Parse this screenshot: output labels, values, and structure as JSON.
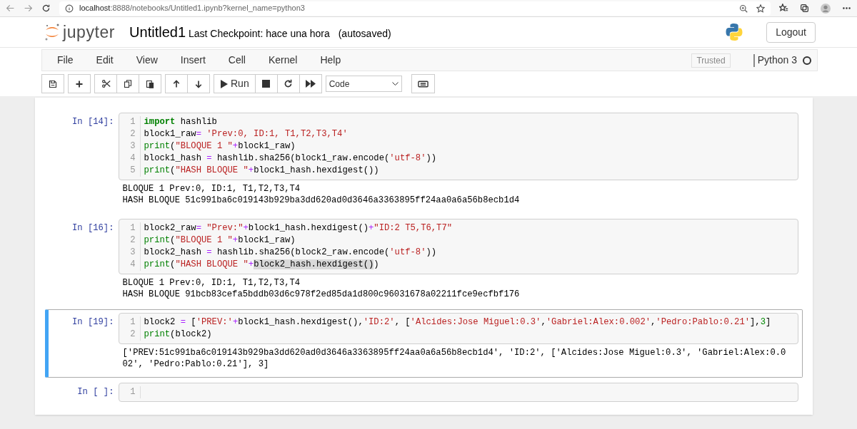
{
  "browser": {
    "url_host": "localhost",
    "url_rest": ":8888/notebooks/Untitled1.ipynb?kernel_name=python3"
  },
  "header": {
    "logo_text": "jupyter",
    "title": "Untitled1",
    "checkpoint": "Last Checkpoint: hace una hora",
    "autosave": "(autosaved)",
    "logout": "Logout"
  },
  "menu": {
    "items": [
      "File",
      "Edit",
      "View",
      "Insert",
      "Cell",
      "Kernel",
      "Help"
    ],
    "trusted": "Trusted",
    "kernel": "Python 3",
    "kernel_busy": false
  },
  "toolbar": {
    "run": "Run",
    "cell_type": "Code"
  },
  "cells": [
    {
      "prompt": "In [14]:",
      "selected": false,
      "lines": [
        {
          "number": "1",
          "tokens": [
            {
              "kind": "keyword",
              "text": "import"
            },
            {
              "kind": "plain",
              "text": " hashlib"
            }
          ]
        },
        {
          "number": "2",
          "tokens": [
            {
              "kind": "plain",
              "text": "block1_raw"
            },
            {
              "kind": "operator",
              "text": "="
            },
            {
              "kind": "string",
              "text": " 'Prev:0, ID:1, T1,T2,T3,T4'"
            }
          ]
        },
        {
          "number": "3",
          "tokens": [
            {
              "kind": "builtin",
              "text": "print"
            },
            {
              "kind": "plain",
              "text": "("
            },
            {
              "kind": "string",
              "text": "\"BLOQUE 1 \""
            },
            {
              "kind": "operator",
              "text": "+"
            },
            {
              "kind": "plain",
              "text": "block1_raw)"
            }
          ]
        },
        {
          "number": "4",
          "tokens": [
            {
              "kind": "plain",
              "text": "block1_hash "
            },
            {
              "kind": "operator",
              "text": "="
            },
            {
              "kind": "plain",
              "text": " hashlib.sha256(block1_raw.encode("
            },
            {
              "kind": "string",
              "text": "'utf-8'"
            },
            {
              "kind": "plain",
              "text": "))"
            }
          ]
        },
        {
          "number": "5",
          "tokens": [
            {
              "kind": "builtin",
              "text": "print"
            },
            {
              "kind": "plain",
              "text": "("
            },
            {
              "kind": "string",
              "text": "\"HASH BLOQUE \""
            },
            {
              "kind": "operator",
              "text": "+"
            },
            {
              "kind": "plain",
              "text": "block1_hash.hexdigest())"
            }
          ]
        }
      ],
      "output": [
        "BLOQUE 1 Prev:0, ID:1, T1,T2,T3,T4",
        "HASH BLOQUE 51c991ba6c019143b929ba3dd620ad0d3646a3363895ff24aa0a6a56b8ecb1d4"
      ]
    },
    {
      "prompt": "In [16]:",
      "selected": false,
      "lines": [
        {
          "number": "1",
          "tokens": [
            {
              "kind": "plain",
              "text": "block2_raw"
            },
            {
              "kind": "operator",
              "text": "="
            },
            {
              "kind": "string",
              "text": " \"Prev:\""
            },
            {
              "kind": "operator",
              "text": "+"
            },
            {
              "kind": "plain",
              "text": "block1_hash.hexdigest()"
            },
            {
              "kind": "operator",
              "text": "+"
            },
            {
              "kind": "string",
              "text": "\"ID:2 T5,T6,T7\""
            }
          ]
        },
        {
          "number": "2",
          "tokens": [
            {
              "kind": "builtin",
              "text": "print"
            },
            {
              "kind": "plain",
              "text": "("
            },
            {
              "kind": "string",
              "text": "\"BLOQUE 1 \""
            },
            {
              "kind": "operator",
              "text": "+"
            },
            {
              "kind": "plain",
              "text": "block1_raw)"
            }
          ]
        },
        {
          "number": "3",
          "tokens": [
            {
              "kind": "plain",
              "text": "block2_hash "
            },
            {
              "kind": "operator",
              "text": "="
            },
            {
              "kind": "plain",
              "text": " hashlib.sha256(block2_raw.encode("
            },
            {
              "kind": "string",
              "text": "'utf-8'"
            },
            {
              "kind": "plain",
              "text": "))"
            }
          ]
        },
        {
          "number": "4",
          "tokens": [
            {
              "kind": "builtin",
              "text": "print"
            },
            {
              "kind": "plain",
              "text": "("
            },
            {
              "kind": "string",
              "text": "\"HASH BLOQUE \""
            },
            {
              "kind": "operator",
              "text": "+"
            },
            {
              "kind": "highlight",
              "text": "block2_hash.hexdigest()"
            },
            {
              "kind": "plain",
              "text": ")"
            }
          ]
        }
      ],
      "output": [
        "BLOQUE 1 Prev:0, ID:1, T1,T2,T3,T4",
        "HASH BLOQUE 91bcb83cefa5bddb03d6c978f2ed85da1d800c96031678a02211fce9ecfbf176"
      ]
    },
    {
      "prompt": "In [19]:",
      "selected": true,
      "lines": [
        {
          "number": "1",
          "tokens": [
            {
              "kind": "plain",
              "text": "block2 "
            },
            {
              "kind": "operator",
              "text": "="
            },
            {
              "kind": "plain",
              "text": " ["
            },
            {
              "kind": "string",
              "text": "'PREV:'"
            },
            {
              "kind": "operator",
              "text": "+"
            },
            {
              "kind": "plain",
              "text": "block1_hash.hexdigest(),"
            },
            {
              "kind": "string",
              "text": "'ID:2'"
            },
            {
              "kind": "plain",
              "text": ", ["
            },
            {
              "kind": "string",
              "text": "'Alcides:Jose Miguel:0.3'"
            },
            {
              "kind": "plain",
              "text": ","
            },
            {
              "kind": "string",
              "text": "'Gabriel:Alex:0.002'"
            },
            {
              "kind": "plain",
              "text": ","
            },
            {
              "kind": "string",
              "text": "'Pedro:Pablo:0.21'"
            },
            {
              "kind": "plain",
              "text": "],"
            },
            {
              "kind": "number",
              "text": "3"
            },
            {
              "kind": "plain",
              "text": "]"
            }
          ]
        },
        {
          "number": "2",
          "tokens": [
            {
              "kind": "builtin",
              "text": "print"
            },
            {
              "kind": "plain",
              "text": "(block2)"
            }
          ]
        }
      ],
      "output": [
        "['PREV:51c991ba6c019143b929ba3dd620ad0d3646a3363895ff24aa0a6a56b8ecb1d4', 'ID:2', ['Alcides:Jose Miguel:0.3', 'Gabriel:Alex:0.0",
        "02', 'Pedro:Pablo:0.21'], 3]"
      ]
    },
    {
      "prompt": "In [ ]:",
      "selected": false,
      "lines": [
        {
          "number": "1"
        }
      ]
    }
  ]
}
